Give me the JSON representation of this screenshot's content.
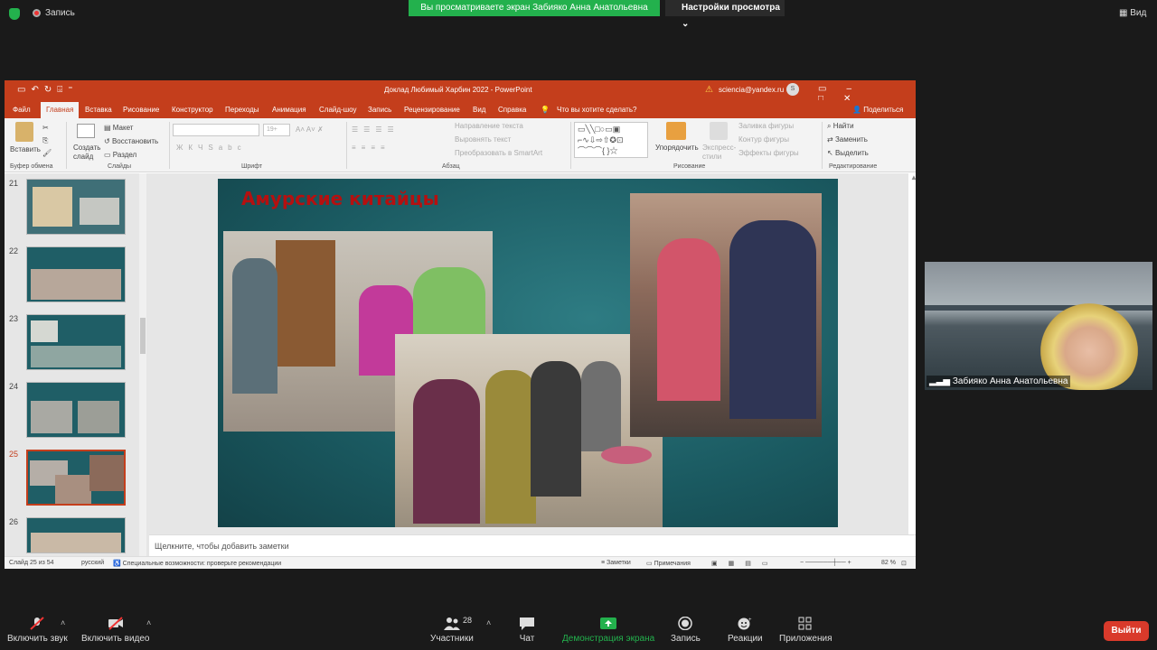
{
  "zoom": {
    "recording": "Запись",
    "banner": "Вы просматриваете экран Забияко Анна Анатольевна",
    "view_settings": "Настройки просмотра",
    "view": "Вид",
    "participant_name": "Забияко Анна Анатольевна",
    "participants_count": "28",
    "toolbar": {
      "mute": "Включить звук",
      "video": "Включить видео",
      "participants": "Участники",
      "chat": "Чат",
      "share": "Демонстрация экрана",
      "record": "Запись",
      "reactions": "Реакции",
      "apps": "Приложения",
      "exit": "Выйти"
    },
    "colors": {
      "green": "#23b14d",
      "exit": "#d93a2b"
    }
  },
  "ppt": {
    "title": "Доклад Любимый Харбин 2022  -  PowerPoint",
    "account": "sciencia@yandex.ru",
    "account_badge": "S",
    "tabs": [
      "Файл",
      "Главная",
      "Вставка",
      "Рисование",
      "Конструктор",
      "Переходы",
      "Анимация",
      "Слайд-шоу",
      "Запись",
      "Рецензирование",
      "Вид",
      "Справка"
    ],
    "active_tab": "Главная",
    "tell_me": "Что вы хотите сделать?",
    "share": "Поделиться",
    "ribbon": {
      "paste": "Вставить",
      "clipboard": "Буфер обмена",
      "new_slide": "Создать слайд",
      "layout": "Макет",
      "reset": "Восстановить",
      "section": "Раздел",
      "slides": "Слайды",
      "font": "Шрифт",
      "font_size": "19+",
      "text_direction": "Направление текста",
      "align_text": "Выровнять текст",
      "smartart": "Преобразовать в SmartArt",
      "paragraph": "Абзац",
      "arrange": "Упорядочить",
      "quick_styles": "Экспресс-стили",
      "shape_fill": "Заливка фигуры",
      "shape_outline": "Контур фигуры",
      "shape_effects": "Эффекты фигуры",
      "drawing": "Рисование",
      "find": "Найти",
      "replace": "Заменить",
      "select": "Выделить",
      "editing": "Редактирование"
    },
    "slide_numbers": [
      "21",
      "22",
      "23",
      "24",
      "25",
      "26"
    ],
    "selected_slide": "25",
    "slide_title": "Амурские китайцы",
    "notes_placeholder": "Щелкните, чтобы добавить заметки",
    "status": {
      "slide": "Слайд 25 из 54",
      "language": "русский",
      "accessibility": "Специальные возможности: проверьте рекомендации",
      "notes": "Заметки",
      "comments": "Примечания",
      "zoom": "82 %"
    },
    "accent": "#c43e1c"
  }
}
